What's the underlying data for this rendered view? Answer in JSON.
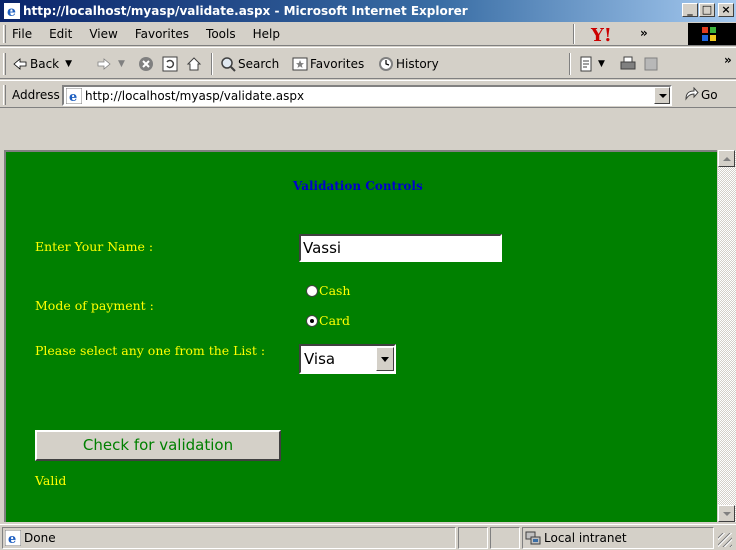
{
  "window": {
    "title": "http://localhost/myasp/validate.aspx - Microsoft Internet Explorer",
    "minimize": "_",
    "maximize": "□",
    "close": "×"
  },
  "menu": {
    "items": [
      "File",
      "Edit",
      "View",
      "Favorites",
      "Tools",
      "Help"
    ],
    "chevron": "»"
  },
  "toolbar": {
    "back": "Back",
    "search": "Search",
    "favorites": "Favorites",
    "history": "History",
    "chevron": "»"
  },
  "address": {
    "label": "Address",
    "url": "http://localhost/myasp/validate.aspx",
    "go": "Go"
  },
  "page": {
    "heading": "Validation Controls",
    "name_label": "Enter Your Name :",
    "name_value": "Vassi",
    "payment_label": "Mode of payment :",
    "payment_options": [
      "Cash",
      "Card"
    ],
    "payment_selected": "Card",
    "list_label": "Please select any one from the List :",
    "list_value": "Visa",
    "button_label": "Check for validation",
    "result_text": "Valid"
  },
  "status": {
    "text": "Done",
    "zone": "Local intranet"
  },
  "colors": {
    "page_bg": "#008000",
    "label_color": "#ffff00",
    "heading_color": "#0000cc",
    "chrome": "#d4d0c8"
  }
}
